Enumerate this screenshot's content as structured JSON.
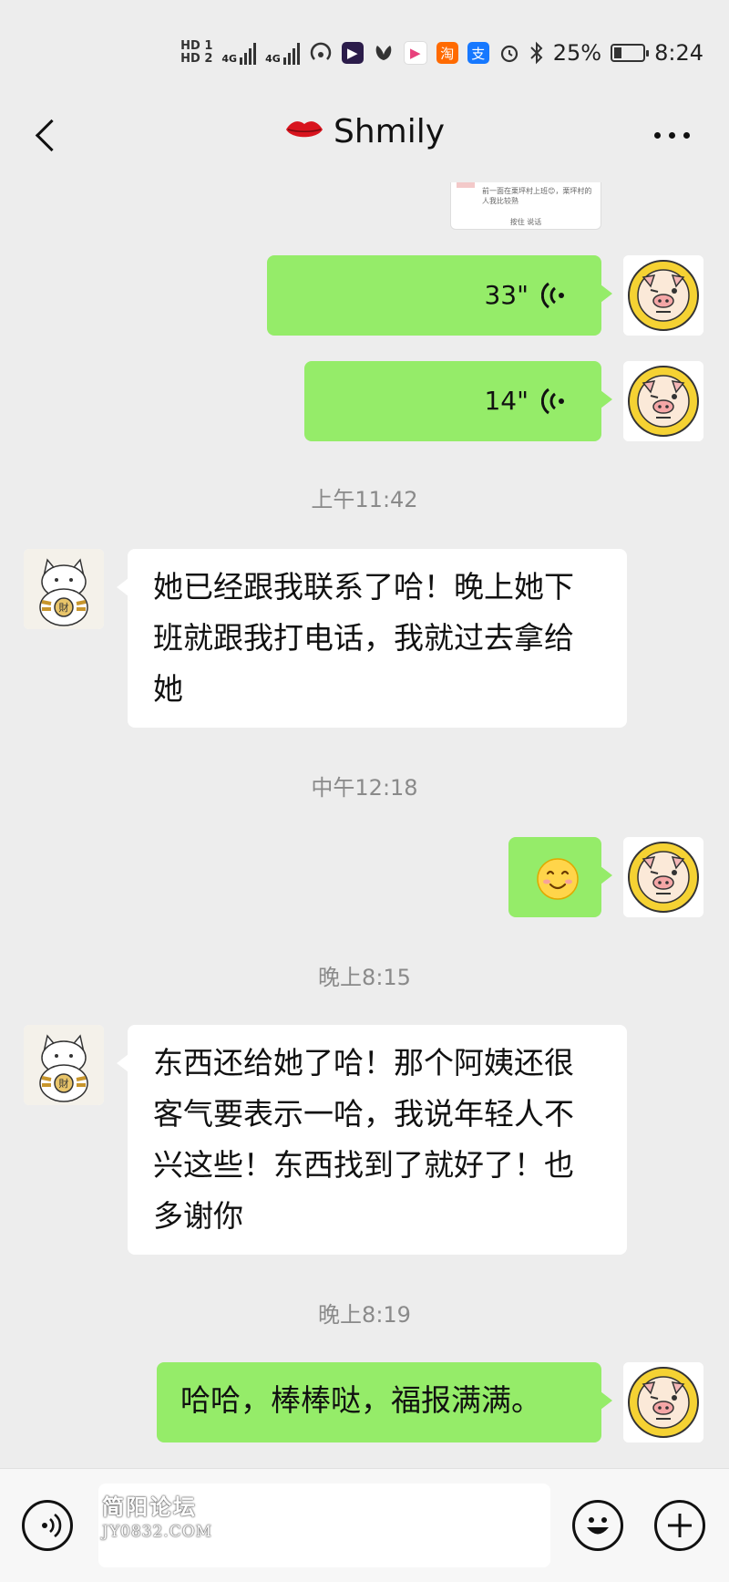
{
  "status_bar": {
    "sim1": "HD 1",
    "sim2": "HD 2",
    "net1": "4G",
    "net2": "4G",
    "app_taobao": "淘",
    "app_alipay": "支",
    "battery_percent": "25%",
    "battery_level": 0.25,
    "time": "8:24"
  },
  "header": {
    "title": "Shmily",
    "title_icon": "lips-icon",
    "back_icon": "back-chevron-icon",
    "more_icon": "more-dots-icon"
  },
  "chat": {
    "preview_thumbnail": {
      "text": "前一面在栗坪村上班😊，栗坪村的人我比较熟",
      "footer": "按住 说话"
    },
    "voice_1": {
      "duration": "33\""
    },
    "voice_2": {
      "duration": "14\""
    },
    "time_1": "上午11:42",
    "msg_1": "她已经跟我联系了哈！晚上她下班就跟我打电话，我就过去拿给她",
    "time_2": "中午12:18",
    "emoji_msg": "smile-emoji",
    "time_3": "晚上8:15",
    "msg_2": "东西还给她了哈！那个阿姨还很客气要表示一哈，我说年轻人不兴这些！东西找到了就好了！也多谢你",
    "time_4": "晚上8:19",
    "msg_3": "哈哈，棒棒哒，福报满满。"
  },
  "input_bar": {
    "voice_icon": "voice-input-icon",
    "emoji_icon": "emoji-icon",
    "plus_icon": "plus-icon",
    "watermark_line1": "简阳论坛",
    "watermark_line2": "JY0832.COM"
  },
  "colors": {
    "my_bubble": "#95ec69",
    "other_bubble": "#ffffff",
    "background": "#ededed"
  }
}
